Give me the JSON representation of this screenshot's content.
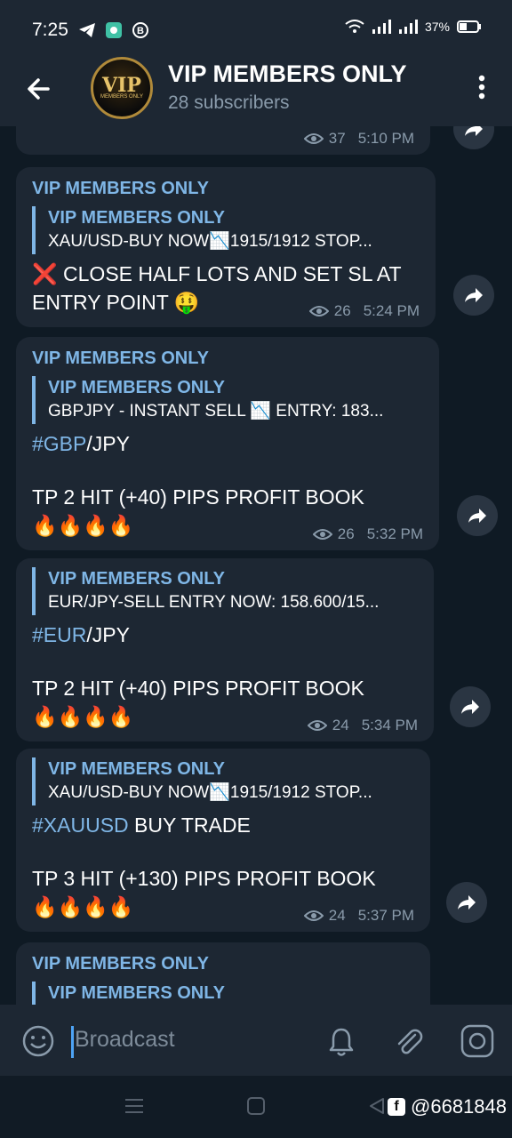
{
  "status_bar": {
    "time": "7:25",
    "battery": "37%"
  },
  "header": {
    "title": "VIP MEMBERS ONLY",
    "subtitle": "28 subscribers",
    "avatar_text": "VIP",
    "avatar_small": "MEMBERS ONLY"
  },
  "messages": [
    {
      "emoji_row": "🔥🔥🔥🔥",
      "views": "37",
      "time": "5:10 PM"
    },
    {
      "author": "VIP MEMBERS ONLY",
      "reply_name": "VIP MEMBERS ONLY",
      "reply_text": "XAU/USD-BUY NOW📉1915/1912  STOP...",
      "text": "❌ CLOSE HALF LOTS AND SET SL AT ENTRY POINT 🤑",
      "views": "26",
      "time": "5:24 PM"
    },
    {
      "author": "VIP MEMBERS ONLY",
      "reply_name": "VIP MEMBERS ONLY",
      "reply_text": "GBPJPY - INSTANT SELL 📉   ENTRY: 183...",
      "tag": "#GBP",
      "tag_rest": "/JPY",
      "line2": "TP 2 HIT (+40) PIPS PROFIT BOOK",
      "emoji_row": "🔥🔥🔥🔥",
      "views": "26",
      "time": "5:32 PM"
    },
    {
      "reply_name": "VIP MEMBERS ONLY",
      "reply_text": "EUR/JPY-SELL ENTRY NOW: 158.600/15...",
      "tag": "#EUR",
      "tag_rest": "/JPY",
      "line2": "TP 2 HIT (+40) PIPS PROFIT BOOK",
      "emoji_row": "🔥🔥🔥🔥",
      "views": "24",
      "time": "5:34 PM"
    },
    {
      "reply_name": "VIP MEMBERS ONLY",
      "reply_text": "XAU/USD-BUY NOW📉1915/1912  STOP...",
      "tag": "#XAUUSD",
      "tag_rest": " BUY TRADE",
      "line2": "TP 3 HIT (+130) PIPS PROFIT BOOK",
      "emoji_row": "🔥🔥🔥🔥",
      "views": "24",
      "time": "5:37 PM"
    },
    {
      "author": "VIP MEMBERS ONLY",
      "reply_name": "VIP MEMBERS ONLY"
    }
  ],
  "input": {
    "placeholder": "Broadcast"
  },
  "watermark": {
    "text": "@6681848"
  }
}
